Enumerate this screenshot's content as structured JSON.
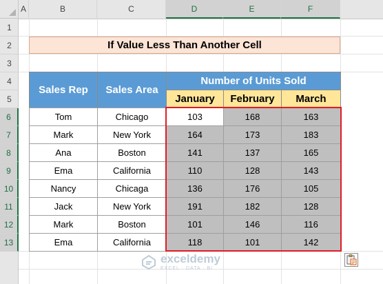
{
  "columns": [
    "A",
    "B",
    "C",
    "D",
    "E",
    "F"
  ],
  "rows": [
    "1",
    "2",
    "3",
    "4",
    "5",
    "6",
    "7",
    "8",
    "9",
    "10",
    "11",
    "12",
    "13"
  ],
  "title": "If Value Less Than Another Cell",
  "table": {
    "sales_rep_header": "Sales Rep",
    "sales_area_header": "Sales Area",
    "group_header": "Number of Units Sold",
    "months": [
      "January",
      "February",
      "March"
    ],
    "records": [
      {
        "rep": "Tom",
        "area": "Chicago",
        "jan": "103",
        "feb": "168",
        "mar": "163"
      },
      {
        "rep": "Mark",
        "area": "New York",
        "jan": "164",
        "feb": "173",
        "mar": "183"
      },
      {
        "rep": "Ana",
        "area": "Boston",
        "jan": "141",
        "feb": "137",
        "mar": "165"
      },
      {
        "rep": "Ema",
        "area": "California",
        "jan": "110",
        "feb": "128",
        "mar": "143"
      },
      {
        "rep": "Nancy",
        "area": "Chicaga",
        "jan": "136",
        "feb": "176",
        "mar": "105"
      },
      {
        "rep": "Jack",
        "area": "New York",
        "jan": "191",
        "feb": "182",
        "mar": "128"
      },
      {
        "rep": "Mark",
        "area": "Boston",
        "jan": "101",
        "feb": "146",
        "mar": "116"
      },
      {
        "rep": "Ema",
        "area": "California",
        "jan": "118",
        "feb": "101",
        "mar": "142"
      }
    ]
  },
  "watermark": {
    "name": "exceldemy",
    "tagline": "EXCEL · DATA · BI"
  },
  "colors": {
    "accent": "#217346",
    "header_blue": "#5b9bd5",
    "header_yellow": "#ffe699",
    "title_fill": "#fce4d6",
    "selection": "#e01b24",
    "highlight_fill": "#bfbfbf"
  }
}
